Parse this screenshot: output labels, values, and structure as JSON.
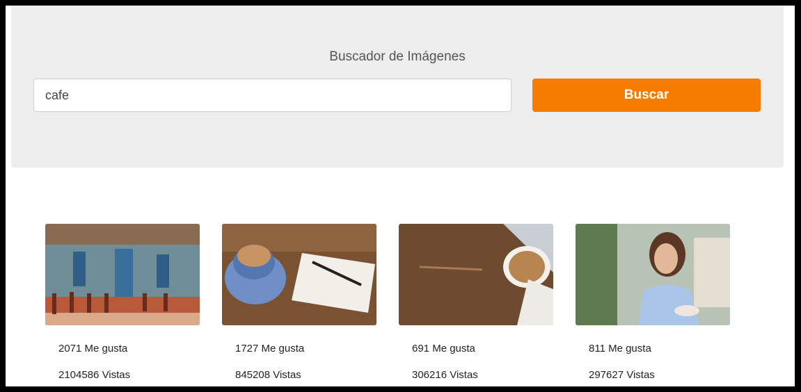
{
  "header": {
    "title": "Buscador de Imágenes",
    "search_value": "cafe",
    "search_button_label": "Buscar"
  },
  "colors": {
    "accent": "#f57c00",
    "jumbotron": "#ededed"
  },
  "results": [
    {
      "image": "cafe-street-facade-image",
      "likes": "2071 Me gusta",
      "views": "2104586 Vistas"
    },
    {
      "image": "coffee-cup-notebook-image",
      "likes": "1727 Me gusta",
      "views": "845208 Vistas"
    },
    {
      "image": "latte-laptop-desk-image",
      "likes": "691 Me gusta",
      "views": "306216 Vistas"
    },
    {
      "image": "woman-phone-cafe-image",
      "likes": "811 Me gusta",
      "views": "297627 Vistas"
    }
  ]
}
